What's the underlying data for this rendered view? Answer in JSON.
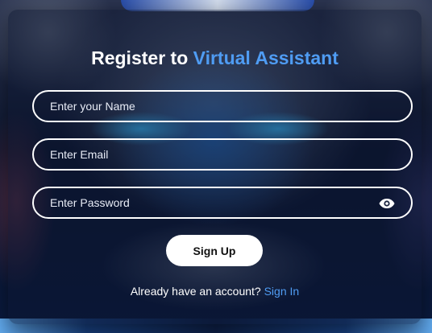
{
  "header": {
    "title_prefix": "Register to",
    "title_accent": "Virtual Assistant"
  },
  "form": {
    "name_placeholder": "Enter your Name",
    "email_placeholder": "Enter Email",
    "password_placeholder": "Enter Password",
    "password_toggle_icon": "eye-icon",
    "submit_label": "Sign Up"
  },
  "footer": {
    "prompt": "Already have an account?",
    "link_label": "Sign In"
  },
  "colors": {
    "accent": "#4f9cf3",
    "text": "#ffffff",
    "button_bg": "#ffffff",
    "button_text": "#111111"
  }
}
